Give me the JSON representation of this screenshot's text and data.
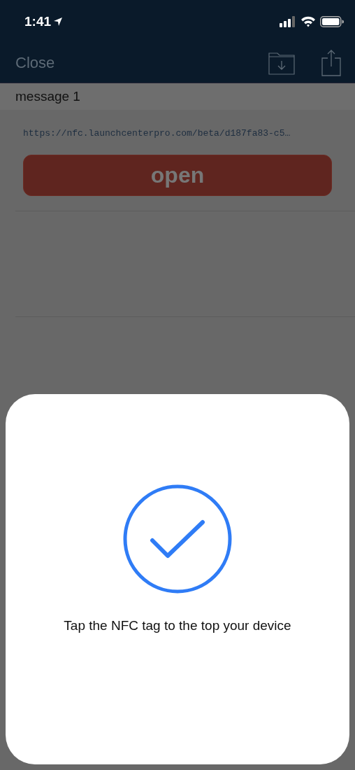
{
  "status_bar": {
    "time": "1:41"
  },
  "nav_bar": {
    "close": "Close"
  },
  "message": {
    "title": "message 1",
    "url": "https://nfc.launchcenterpro.com/beta/d187fa83-c5…",
    "button": "open"
  },
  "nfc_sheet": {
    "done": true,
    "prompt": "Tap the NFC tag to the top your device"
  }
}
